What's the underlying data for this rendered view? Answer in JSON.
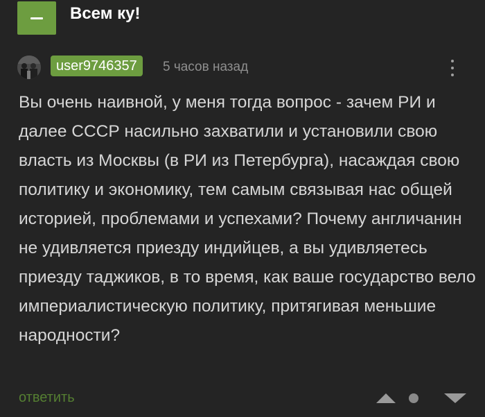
{
  "post": {
    "title": "Всем ку!"
  },
  "comment": {
    "username": "user9746357",
    "timestamp": "5 часов назад",
    "text": "Вы очень наивной, у меня тогда вопрос - зачем РИ и далее СССР насильно захватили и установили свою власть из Москвы (в РИ из Петербурга), насаждая свою политику и экономику, тем самым связывая нас общей историей, проблемами и успехами? Почему англичанин не удивляется приезду индийцев, а вы удивляетесь приезду таджиков, в то время, как ваше государство вело империалистическую политику, притягивая меньшие народности?",
    "reply_label": "ответить"
  },
  "icons": {
    "collapse": "minus-icon",
    "more": "vertical-dots-icon",
    "upvote": "triangle-up-icon",
    "rating": "dot-icon",
    "downvote": "triangle-down-icon"
  },
  "colors": {
    "background": "#242424",
    "accent_green": "#6d9d40",
    "reply_green": "#557f32",
    "text": "#d6d6d6",
    "muted": "#8f8f8f"
  }
}
